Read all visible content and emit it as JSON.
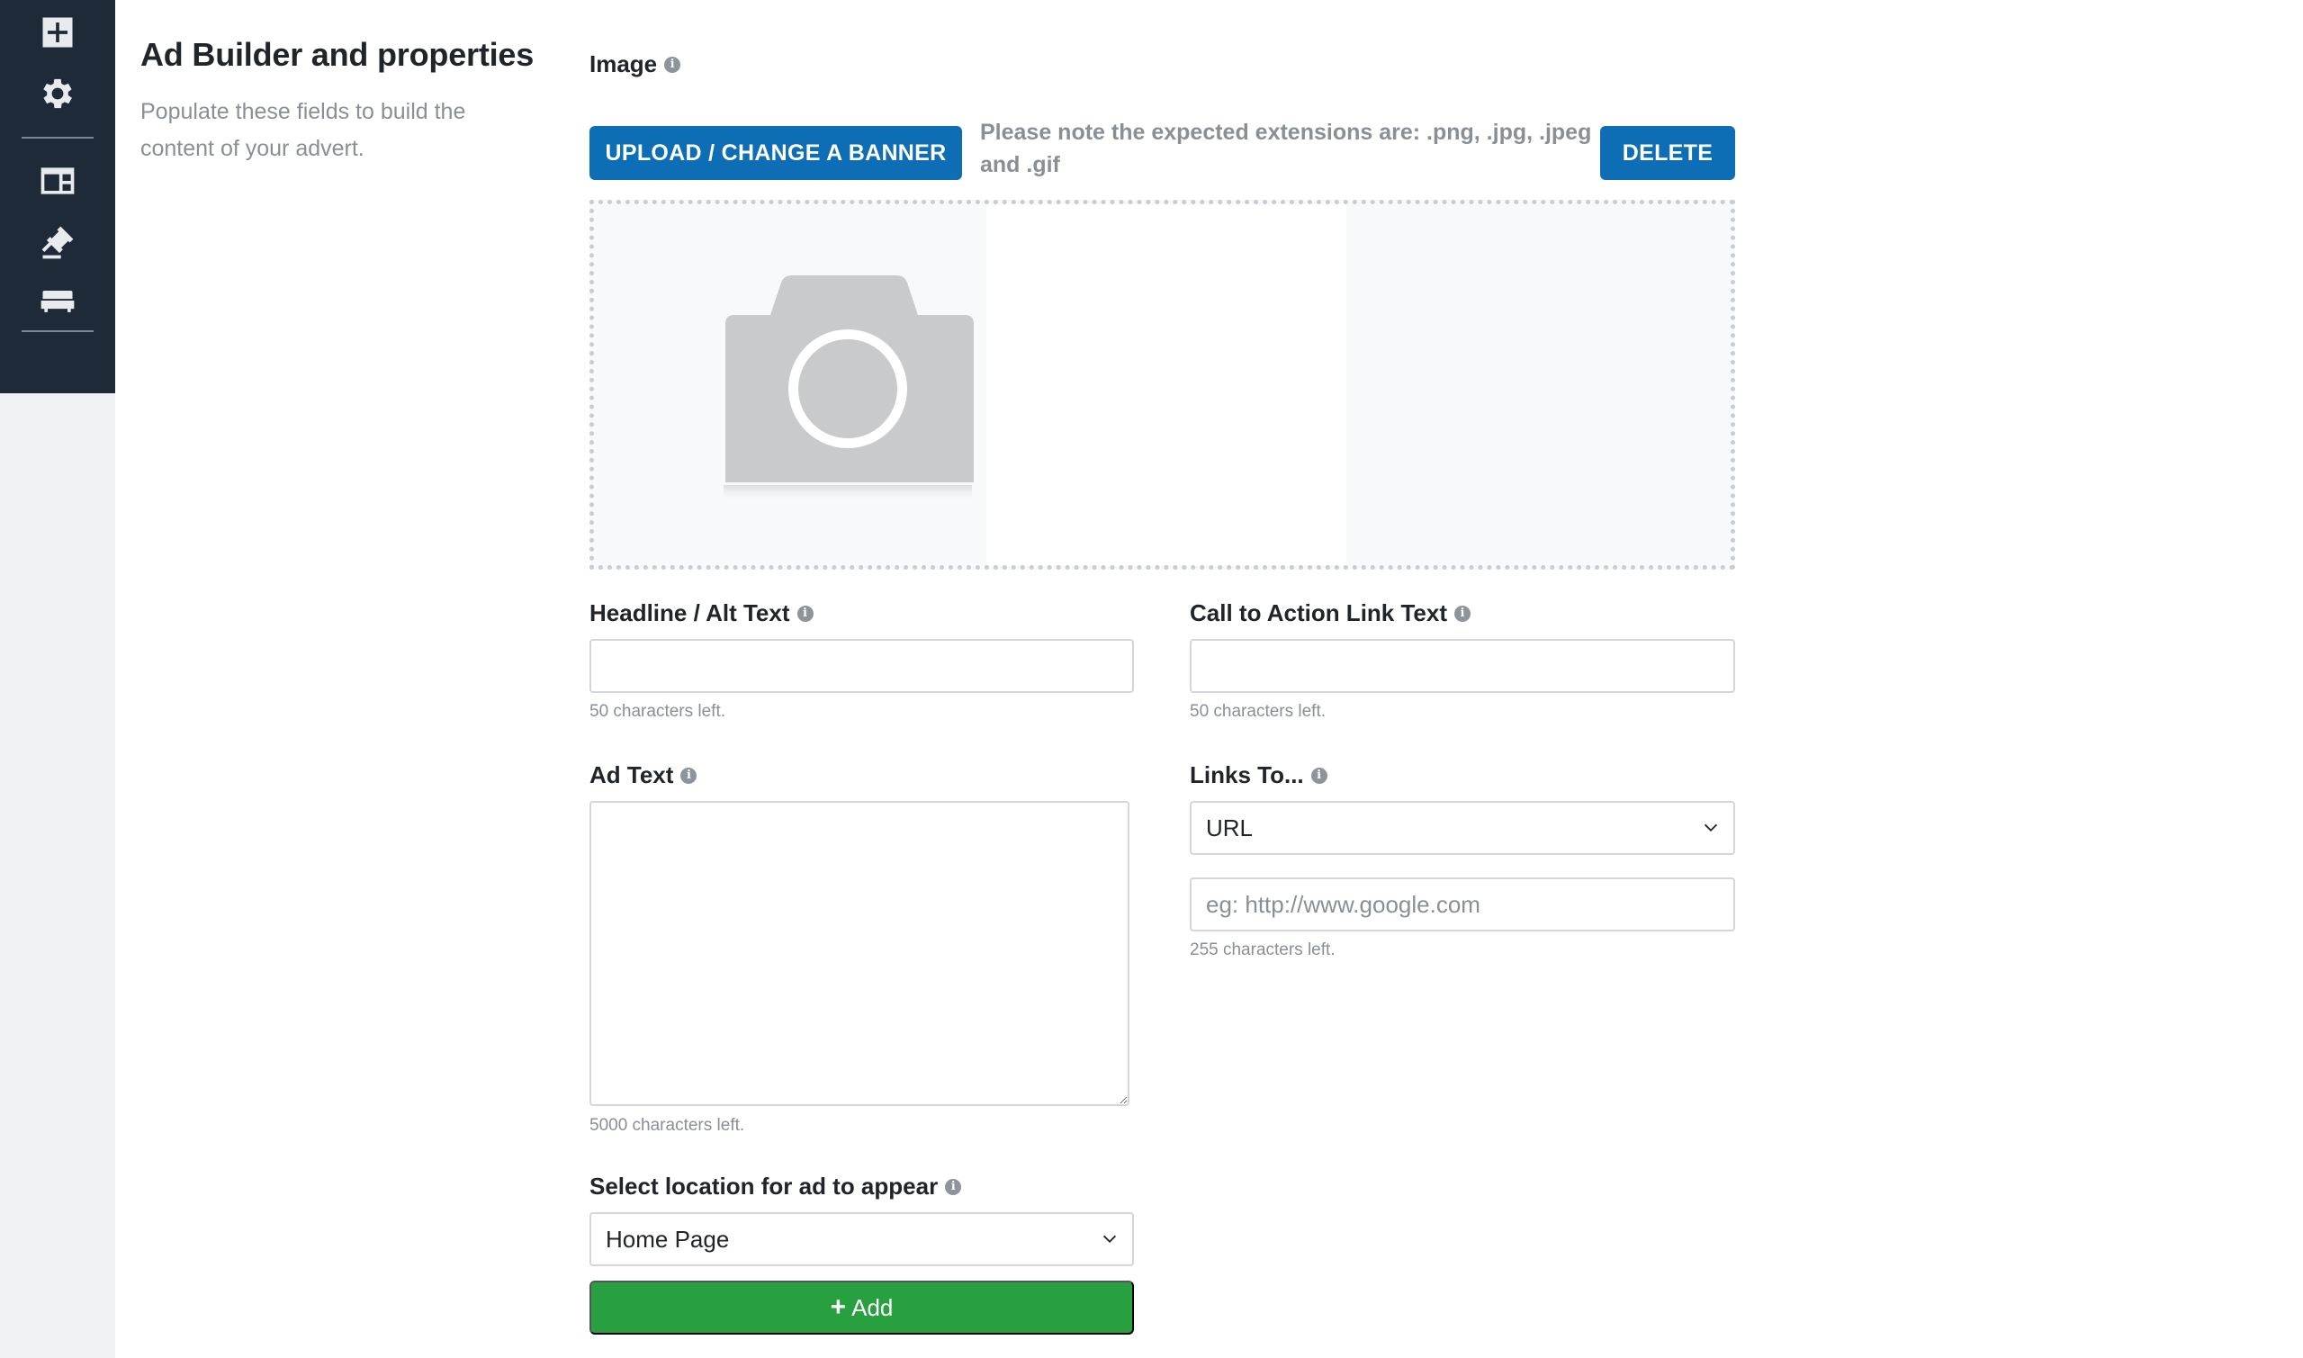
{
  "sidebar": {
    "icons": [
      "add-icon",
      "gear-icon",
      "layout-icon",
      "gavel-icon",
      "bed-icon"
    ]
  },
  "intro": {
    "title": "Ad Builder and properties",
    "description": "Populate these fields to build the content of your advert."
  },
  "image_section": {
    "label": "Image",
    "upload_button": "UPLOAD / CHANGE A BANNER",
    "note": "Please note the expected extensions are: .png, .jpg, .jpeg and .gif",
    "delete_button": "DELETE"
  },
  "headline": {
    "label": "Headline / Alt Text",
    "value": "",
    "helper": "50 characters left."
  },
  "cta": {
    "label": "Call to Action Link Text",
    "value": "",
    "helper": "50 characters left."
  },
  "ad_text": {
    "label": "Ad Text",
    "value": "",
    "helper": "5000 characters left."
  },
  "links_to": {
    "label": "Links To...",
    "selected": "URL",
    "url_placeholder": "eg: http://www.google.com",
    "helper": "255 characters left."
  },
  "location": {
    "label": "Select location for ad to appear",
    "selected": "Home Page"
  },
  "add_button": {
    "label": "Add"
  },
  "colors": {
    "primary": "#0d6eb5",
    "success": "#28a03f",
    "sidebar": "#1f2a38"
  }
}
